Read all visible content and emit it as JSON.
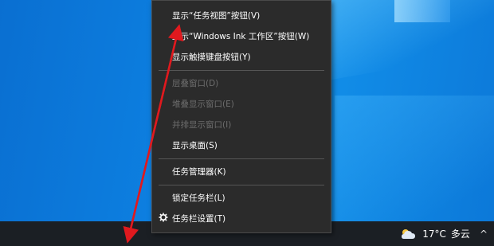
{
  "menu": {
    "items": [
      {
        "label": "显示“任务视图”按钮(V)",
        "enabled": true
      },
      {
        "label": "显示“Windows Ink 工作区”按钮(W)",
        "enabled": true
      },
      {
        "label": "显示触摸键盘按钮(Y)",
        "enabled": true
      },
      {
        "label": "层叠窗口(D)",
        "enabled": false
      },
      {
        "label": "堆叠显示窗口(E)",
        "enabled": false
      },
      {
        "label": "并排显示窗口(I)",
        "enabled": false
      },
      {
        "label": "显示桌面(S)",
        "enabled": true
      },
      {
        "label": "任务管理器(K)",
        "enabled": true
      },
      {
        "label": "锁定任务栏(L)",
        "enabled": true
      },
      {
        "label": "任务栏设置(T)",
        "enabled": true,
        "icon": "gear-icon"
      }
    ]
  },
  "tray": {
    "weather_icon": "cloud-sun-icon",
    "temperature": "17°C",
    "condition": "多云",
    "expand_icon": "chevron-up-icon"
  },
  "annotation": {
    "arrow_color": "#e0191e"
  }
}
